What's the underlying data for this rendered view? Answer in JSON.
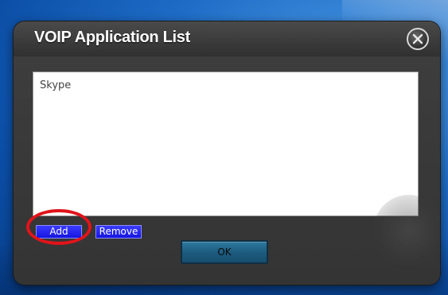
{
  "dialog": {
    "title": "VOIP Application List",
    "close_icon": "close-x-icon"
  },
  "app_list": {
    "items": [
      "Skype"
    ]
  },
  "buttons": {
    "add_label": "Add",
    "remove_label": "Remove",
    "ok_label": "OK"
  },
  "colors": {
    "desktop_blue": "#1e6cc6",
    "dialog_bg": "#3a3a3a",
    "action_button_blue": "#1f1fee",
    "ok_button_teal": "#1d5c80",
    "highlight_red": "#e0141a"
  }
}
